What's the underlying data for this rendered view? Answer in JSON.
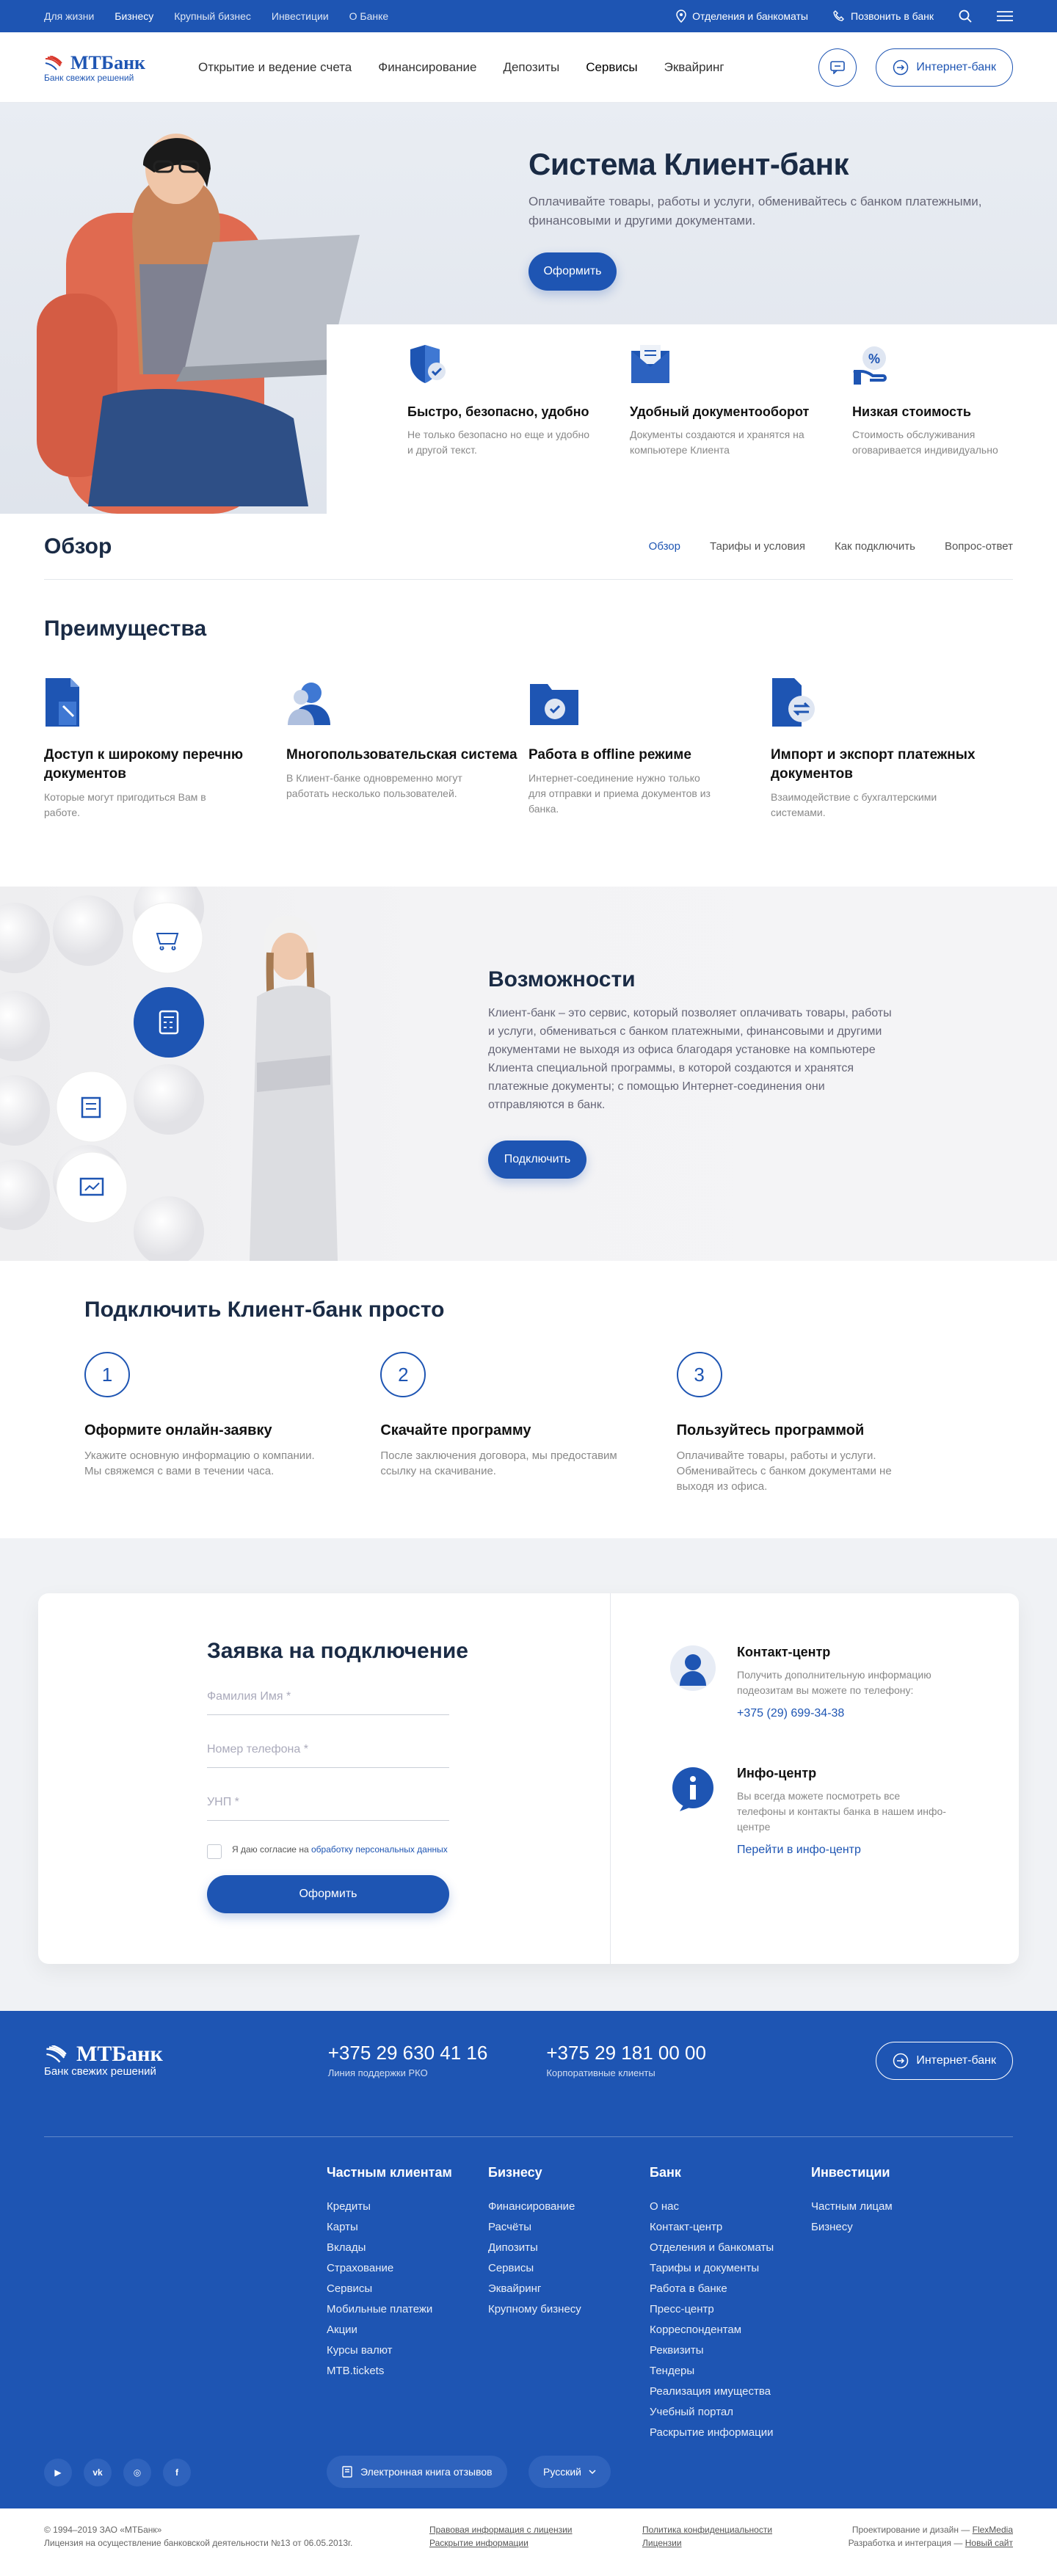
{
  "topbar": {
    "segments": [
      "Для жизни",
      "Бизнесу",
      "Крупный бизнес",
      "Инвестиции",
      "О Банке"
    ],
    "branches": "Отделения и банкоматы",
    "call": "Позвонить в банк"
  },
  "header": {
    "logo_name": "МТБанк",
    "logo_tagline": "Банк свежих решений",
    "nav": [
      "Открытие и ведение счета",
      "Финансирование",
      "Депозиты",
      "Сервисы",
      "Эквайринг"
    ],
    "internet_bank": "Интернет-банк"
  },
  "hero": {
    "title": "Система Клиент-банк",
    "text": "Оплачивайте товары, работы и услуги, обменивайтесь с банком платежными, финансовыми и другими документами.",
    "button": "Оформить",
    "features": [
      {
        "title": "Быстро, безопасно, удобно",
        "text": "Не только безопасно но еще и удобно и другой текст."
      },
      {
        "title": "Удобный документооборот",
        "text": "Документы создаются и хранятся на компьютере Клиента"
      },
      {
        "title": "Низкая стоимость",
        "text": "Стоимость обслуживания оговаривается индивидуально"
      }
    ]
  },
  "overview": {
    "title": "Обзор",
    "tabs": [
      "Обзор",
      "Тарифы и условия",
      "Как подключить",
      "Вопрос-ответ"
    ]
  },
  "advantages": {
    "title": "Преимущества",
    "items": [
      {
        "title": "Доступ к широкому перечню документов",
        "text": "Которые могут пригодиться Вам в работе."
      },
      {
        "title": "Многопользовательская система",
        "text": "В Клиент-банке одновременно могут работать несколько пользователей."
      },
      {
        "title": "Работа в offline режиме",
        "text": "Интернет-соединение нужно только для отправки и приема документов из банка."
      },
      {
        "title": "Импорт и экспорт платежных документов",
        "text": "Взаимодействие с бухгалтерскими системами."
      }
    ]
  },
  "possibilities": {
    "title": "Возможности",
    "text": "Клиент-банк – это сервис, который позволяет оплачивать товары, работы и услуги, обмениваться с банком платежными, финансовыми и другими документами не выходя из офиса благодаря установке на компьютере Клиента специальной программы, в которой создаются и хранятся платежные документы;  с помощью Интернет-соединения они отправляются в банк.",
    "button": "Подключить"
  },
  "steps": {
    "title": "Подключить Клиент-банк просто",
    "items": [
      {
        "num": "1",
        "title": "Оформите онлайн-заявку",
        "text": "Укажите основную информацию о компании. Мы свяжемся с вами в течении часа."
      },
      {
        "num": "2",
        "title": "Скачайте программу",
        "text": "После заключения договора, мы предоставим ссылку на скачивание."
      },
      {
        "num": "3",
        "title": "Пользуйтесь программой",
        "text": "Оплачивайте товары, работы и услуги. Обменивайтесь с банком документами не выходя из офиса."
      }
    ]
  },
  "form": {
    "title": "Заявка на подключение",
    "name_placeholder": "Фамилия Имя *",
    "phone_placeholder": "Номер телефона *",
    "unp_placeholder": "УНП *",
    "consent_text": "Я даю согласие на",
    "consent_link": "обработку персональных данных",
    "button": "Оформить",
    "contact_title": "Контакт-центр",
    "contact_text": "Получить дополнительную информацию подеозитам вы можете по телефону:",
    "contact_phone": "+375 (29) 699-34-38",
    "info_title": "Инфо-центр",
    "info_text": "Вы всегда можете посмотреть все телефоны и контакты банка в нашем инфо-центре",
    "info_link": "Перейти в инфо-центр"
  },
  "footer": {
    "logo_name": "МТБанк",
    "logo_tagline": "Банк свежих решений",
    "phone1": "+375 29 630 41 16",
    "phone1_label": "Линия поддержки РКО",
    "phone2": "+375 29 181 00 00",
    "phone2_label": "Корпоративные клиенты",
    "internet_bank": "Интернет-банк",
    "columns": [
      {
        "title": "Частным клиентам",
        "links": [
          "Кредиты",
          "Карты",
          "Вклады",
          "Страхование",
          "Сервисы",
          "Мобильные платежи",
          "Акции",
          "Курсы валют",
          "MTB.tickets"
        ]
      },
      {
        "title": "Бизнесу",
        "links": [
          "Финансирование",
          "Расчёты",
          "Дипозиты",
          "Сервисы",
          "Эквайринг",
          "Крупному бизнесу"
        ]
      },
      {
        "title": "Банк",
        "links": [
          "О нас",
          "Контакт-центр",
          "Отделения и банкоматы",
          "Тарифы и документы",
          "Работа в банке",
          "Пресс-центр",
          "Корреспондентам",
          "Реквизиты",
          "Тендеры",
          "Реализация имущества",
          "Учебный портал",
          "Раскрытие информации"
        ]
      },
      {
        "title": "Инвестиции",
        "links": [
          "Частным лицам",
          "Бизнесу"
        ]
      }
    ],
    "social": [
      "youtube-icon",
      "vk-icon",
      "instagram-icon",
      "facebook-icon"
    ],
    "feedback_book": "Электронная книга отзывов",
    "language": "Русский"
  },
  "legal": {
    "copyright": "© 1994–2019 ЗАО «МТБанк»",
    "license": "Лицензия на осуществление банковской деятельности №13 от 06.05.2013г.",
    "legal_info": "Правовая информация с лицензии",
    "disclosure": "Раскрытие информации",
    "privacy": "Политика конфиденциальности",
    "licenses": "Лицензии",
    "design_text": "Проектирование и дизайн —",
    "design_link": "FlexMedia",
    "dev_text": "Разработка и интеграция —",
    "dev_link": "Новый сайт"
  },
  "colors": {
    "brand": "#1e55b3",
    "hero_bg": "#e4e8ef",
    "form_bg": "#f0f2f5"
  }
}
